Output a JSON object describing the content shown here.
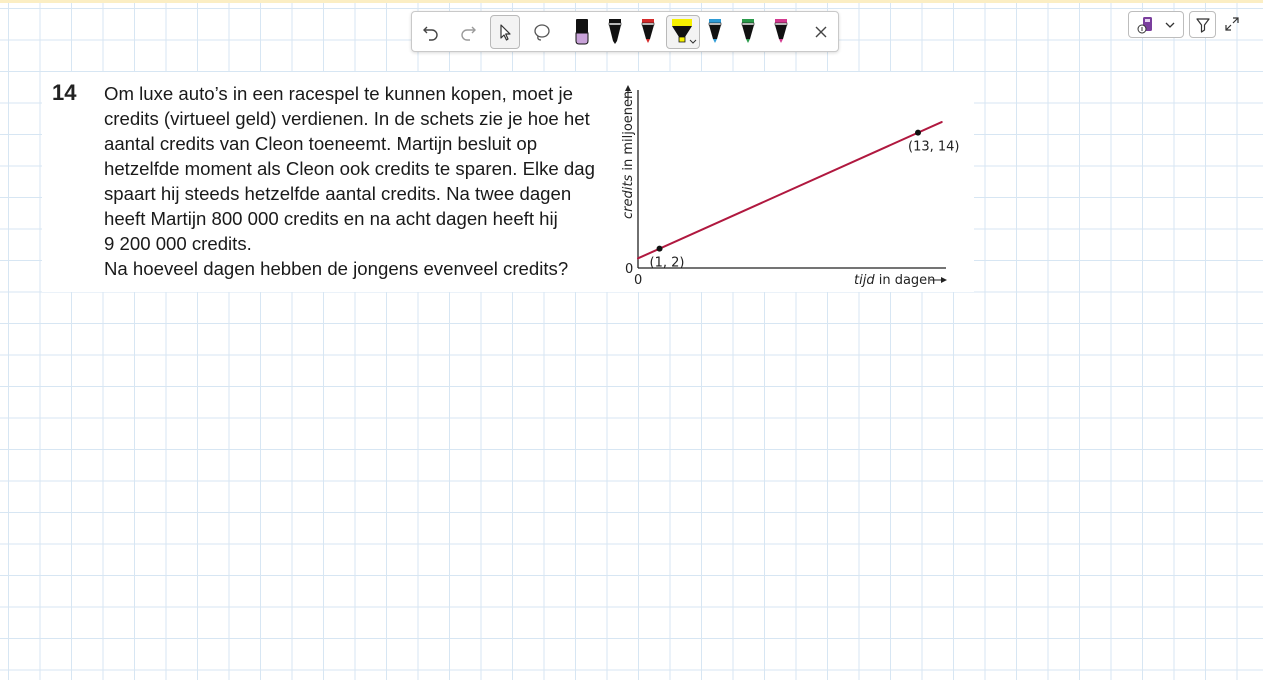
{
  "question": {
    "number": "14",
    "lines": [
      "Om luxe auto’s in een racespel te kunnen kopen, moet je",
      "credits (virtueel geld) verdienen. In de schets zie je hoe het",
      "aantal credits van Cleon toeneemt. Martijn besluit op",
      "hetzelfde moment als Cleon ook credits te sparen. Elke dag",
      "spaart hij steeds hetzelfde aantal credits. Na twee dagen",
      "heeft Martijn 800 000 credits en na acht dagen heeft hij",
      "9 200 000 credits.",
      "Na hoeveel dagen hebben de jongens evenveel credits?"
    ]
  },
  "chart_data": {
    "type": "line",
    "xlabel_italic": "tijd",
    "xlabel_rest": " in dagen",
    "ylabel_italic": "credits",
    "ylabel_rest": " in miljoenen",
    "x_origin_label": "0",
    "y_origin_label": "0",
    "points": [
      {
        "x": 1,
        "y": 2,
        "label": "(1, 2)"
      },
      {
        "x": 13,
        "y": 14,
        "label": "(13, 14)"
      }
    ],
    "xlim": [
      0,
      14.3
    ],
    "ylim": [
      0,
      18
    ],
    "line_color": "#b0183f",
    "grid": false
  },
  "toolbar": {
    "tools": [
      "undo-icon",
      "redo-icon",
      "select-icon",
      "lasso-icon",
      "pen-lavender",
      "pen-black",
      "pen-red",
      "highlighter-yellow",
      "pen-blue",
      "pen-green",
      "pen-pink",
      "close-icon"
    ],
    "pen_colors": {
      "lavender": "#c8a2d8",
      "black": "#111111",
      "red": "#d42a2a",
      "yellow": "#f6f000",
      "blue": "#2e9bd6",
      "green": "#2a9a4a",
      "pink": "#d3398f"
    }
  },
  "accent_color": "#fbeec4"
}
